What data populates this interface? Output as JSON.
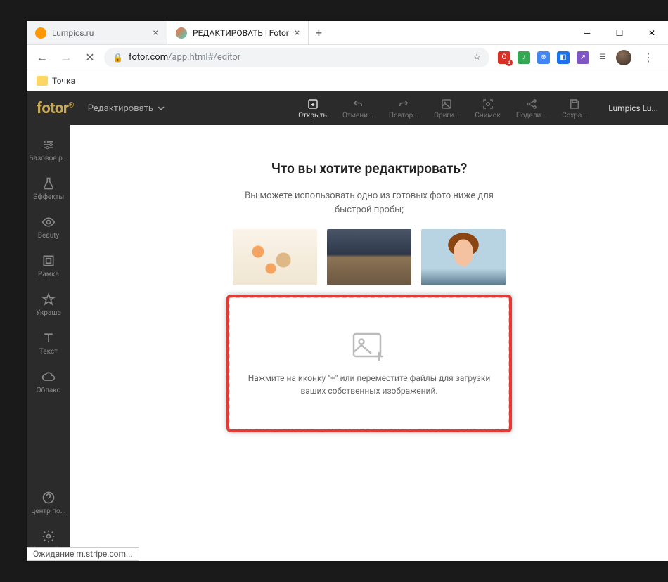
{
  "browser": {
    "tabs": [
      {
        "title": "Lumpics.ru",
        "favicon_bg": "#ff9800",
        "active": false
      },
      {
        "title": "РЕДАКТИРОВАТЬ | Fotor",
        "favicon_bg": "linear-gradient(135deg,#ff6b35,#4ecdc4)",
        "active": true
      }
    ],
    "url_host": "fotor.com",
    "url_path": "/app.html#/editor",
    "bookmark": "Точка",
    "status_text": "Ожидание m.stripe.com...",
    "ext_badge": "3"
  },
  "app": {
    "logo": "fotor",
    "mode": "Редактировать",
    "top_actions": {
      "open": "Открыть",
      "cancel": "Отмени...",
      "repeat": "Повтор...",
      "original": "Ориги...",
      "snapshot": "Снимок",
      "share": "Подели...",
      "save": "Сохра..."
    },
    "user": "Lumpics Lu...",
    "sidebar": {
      "basic": "Базовое р...",
      "effects": "Эффекты",
      "beauty": "Beauty",
      "frame": "Рамка",
      "stickers": "Украше",
      "text": "Текст",
      "cloud": "Облако",
      "help": "центр по...",
      "settings": "Настройки"
    },
    "content": {
      "heading": "Что вы хотите редактировать?",
      "sub1": "Вы можете использовать одно из готовых фото ниже для",
      "sub2": "быстрой пробы;",
      "drop1": "Нажмите на иконку \"+\" или переместите файлы для загрузки",
      "drop2": "ваших собственных изображений."
    }
  }
}
